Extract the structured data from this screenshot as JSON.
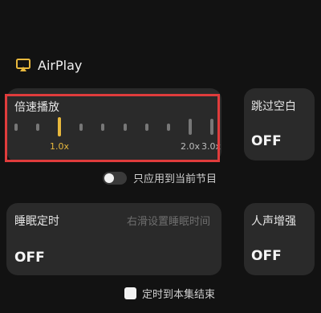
{
  "airplay": {
    "label": "AirPlay",
    "icon": "airplay-icon",
    "accent": "#e8b83d"
  },
  "speed": {
    "title": "倍速播放",
    "tick_count": 10,
    "active_index": 2,
    "large_indices": [
      8,
      9
    ],
    "labels": [
      "1.0x",
      "2.0x",
      "3.0x"
    ]
  },
  "skip": {
    "title": "跳过空白",
    "value": "OFF"
  },
  "apply_current": {
    "label": "只应用到当前节目",
    "enabled": false
  },
  "sleep": {
    "title": "睡眠定时",
    "hint": "右滑设置睡眠时间",
    "value": "OFF"
  },
  "voice": {
    "title": "人声增强",
    "value": "OFF"
  },
  "end_episode": {
    "label": "定时到本集结束",
    "checked": false
  },
  "colors": {
    "background": "#121212",
    "card": "#2a2a2a",
    "accent": "#e8b83d",
    "highlight": "#e03c3c"
  }
}
